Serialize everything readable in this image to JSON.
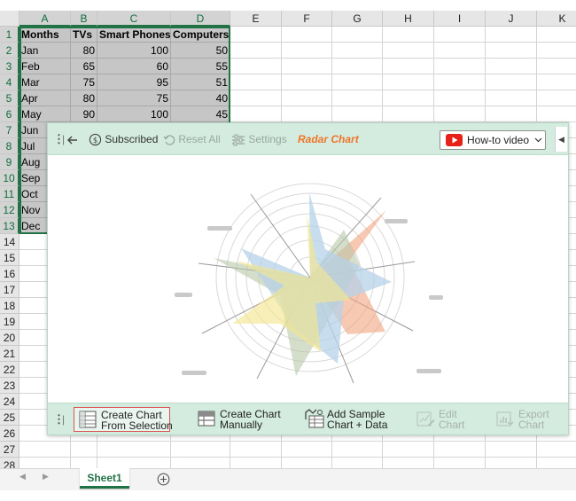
{
  "sheet": {
    "columns": [
      "A",
      "B",
      "C",
      "D",
      "E",
      "F",
      "G",
      "H",
      "I",
      "J",
      "K"
    ],
    "rows": [
      "1",
      "2",
      "3",
      "4",
      "5",
      "6",
      "7",
      "8",
      "9",
      "10",
      "11",
      "12",
      "13",
      "14",
      "15",
      "16",
      "17",
      "18",
      "19",
      "20",
      "21",
      "22",
      "23",
      "24",
      "25",
      "26",
      "27",
      "28"
    ],
    "header": [
      "Months",
      "TVs",
      "Smart Phones",
      "Computers"
    ],
    "data": [
      [
        "Jan",
        "80",
        "100",
        "50"
      ],
      [
        "Feb",
        "65",
        "60",
        "55"
      ],
      [
        "Mar",
        "75",
        "95",
        "51"
      ],
      [
        "Apr",
        "80",
        "75",
        "40"
      ],
      [
        "May",
        "90",
        "100",
        "45"
      ],
      [
        "Jun",
        "",
        "",
        ""
      ],
      [
        "Jul",
        "",
        "",
        ""
      ],
      [
        "Aug",
        "",
        "",
        ""
      ],
      [
        "Sep",
        "",
        "",
        ""
      ],
      [
        "Oct",
        "",
        "",
        ""
      ],
      [
        "Nov",
        "",
        "",
        ""
      ],
      [
        "Dec",
        "",
        "",
        ""
      ]
    ]
  },
  "panel": {
    "toolbar": {
      "subscribed_label": "Subscribed",
      "reset_label": "Reset All",
      "settings_label": "Settings",
      "title": "Radar Chart",
      "howto_label": "How-to video"
    },
    "bottom": {
      "create_selection_line1": "Create Chart",
      "create_selection_line2": "From Selection",
      "create_manual_line1": "Create Chart",
      "create_manual_line2": "Manually",
      "add_sample_line1": "Add Sample",
      "add_sample_line2": "Chart + Data",
      "edit_line1": "Edit",
      "edit_line2": "Chart",
      "export_line1": "Export",
      "export_line2": "Chart"
    }
  },
  "tabs": {
    "sheet1_label": "Sheet1"
  },
  "colors": {
    "excel_green": "#217346",
    "panel_bg": "#d4ece0",
    "title_orange": "#f07427",
    "youtube_red": "#e62117"
  }
}
